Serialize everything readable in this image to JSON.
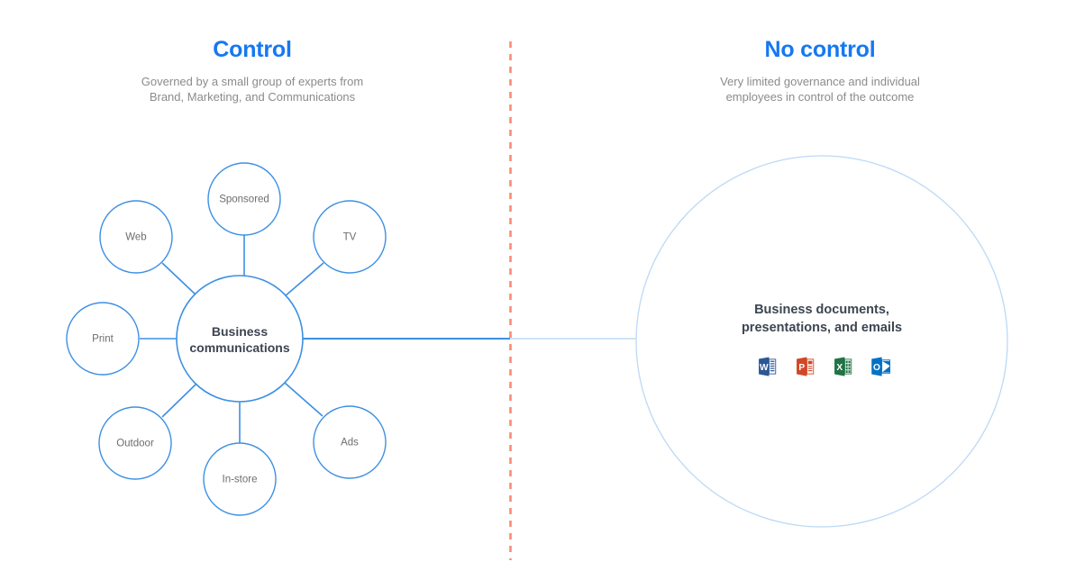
{
  "panels": {
    "left": {
      "title": "Control",
      "subtitle": "Governed by a small group of experts from Brand, Marketing, and Communications",
      "subtitle_line1": "Governed by a small group of experts from",
      "subtitle_line2": "Brand, Marketing, and Communications"
    },
    "right": {
      "title": "No control",
      "subtitle": "Very limited governance and individual employees in control of the outcome",
      "subtitle_line1": "Very limited governance and individual",
      "subtitle_line2": "employees in control of the outcome"
    }
  },
  "hub": {
    "label": "Business communications",
    "label_line1": "Business",
    "label_line2": "communications"
  },
  "nodes": [
    {
      "id": "sponsored",
      "label": "Sponsored"
    },
    {
      "id": "web",
      "label": "Web"
    },
    {
      "id": "tv",
      "label": "TV"
    },
    {
      "id": "print",
      "label": "Print"
    },
    {
      "id": "outdoor",
      "label": "Outdoor"
    },
    {
      "id": "instore",
      "label": "In-store"
    },
    {
      "id": "ads",
      "label": "Ads"
    }
  ],
  "big_circle": {
    "label": "Business documents, presentations, and emails",
    "label_line1": "Business documents,",
    "label_line2": "presentations, and emails",
    "icons": [
      {
        "name": "word-icon",
        "letter": "W",
        "app": "Word",
        "color": "#2b5797"
      },
      {
        "name": "powerpoint-icon",
        "letter": "P",
        "app": "PowerPoint",
        "color": "#d24726"
      },
      {
        "name": "excel-icon",
        "letter": "X",
        "app": "Excel",
        "color": "#217346"
      },
      {
        "name": "outlook-icon",
        "letter": "O",
        "app": "Outlook",
        "color": "#0072c6"
      }
    ]
  },
  "colors": {
    "accent_blue": "#1678f2",
    "node_stroke": "#3d90e3",
    "faint_stroke": "#bcd9f5",
    "divider": "#f98b73",
    "subtitle_gray": "#8b8b8b",
    "label_gray": "#6d6d6d",
    "dark_text": "#3d4551"
  }
}
